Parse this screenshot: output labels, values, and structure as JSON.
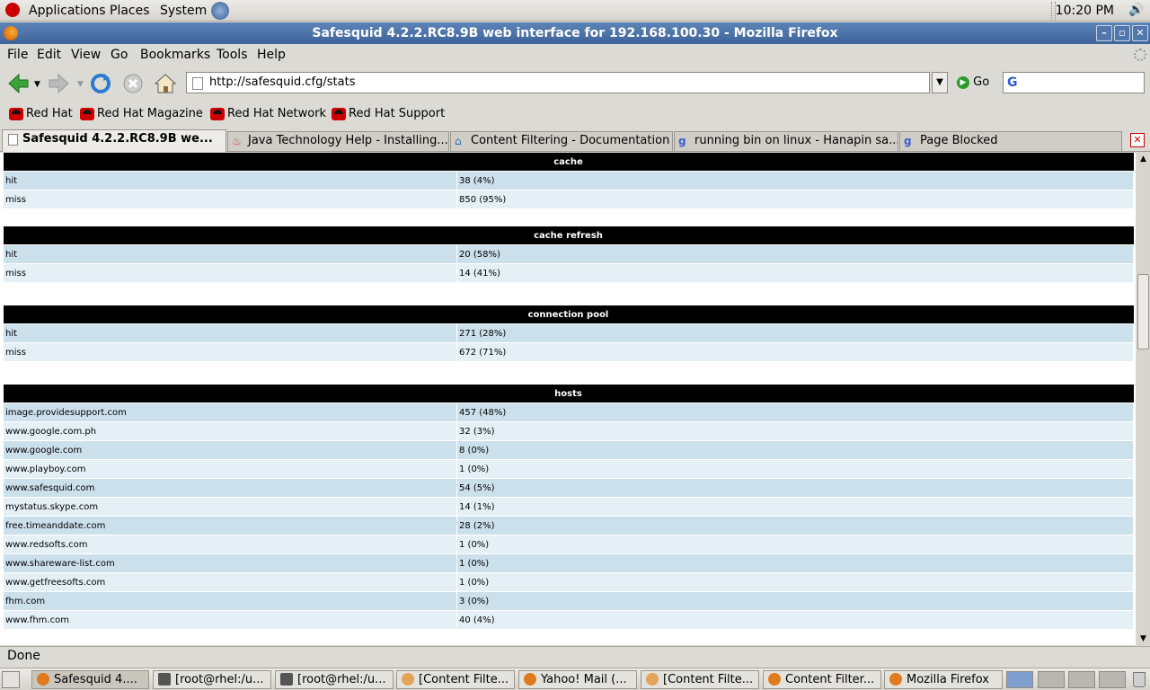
{
  "panel": {
    "menus": [
      "Applications",
      "Places",
      "System"
    ],
    "clock": "10:20 PM"
  },
  "window": {
    "title": "Safesquid 4.2.2.RC8.9B web interface for 192.168.100.30 - Mozilla Firefox"
  },
  "menubar": [
    "File",
    "Edit",
    "View",
    "Go",
    "Bookmarks",
    "Tools",
    "Help"
  ],
  "navbar": {
    "url": "http://safesquid.cfg/stats",
    "go_label": "Go"
  },
  "bookmarks": [
    "Red Hat",
    "Red Hat Magazine",
    "Red Hat Network",
    "Red Hat Support"
  ],
  "tabs": [
    "Safesquid 4.2.2.RC8.9B we...",
    "Java Technology Help - Installing...",
    "Content Filtering - Documentation",
    "running bin on linux - Hanapin sa...",
    "Page Blocked"
  ],
  "sections": {
    "cache": {
      "title": "cache",
      "rows": [
        [
          "hit",
          "38 (4%)"
        ],
        [
          "miss",
          "850 (95%)"
        ]
      ]
    },
    "cache_refresh": {
      "title": "cache refresh",
      "rows": [
        [
          "hit",
          "20 (58%)"
        ],
        [
          "miss",
          "14 (41%)"
        ]
      ]
    },
    "connection_pool": {
      "title": "connection pool",
      "rows": [
        [
          "hit",
          "271 (28%)"
        ],
        [
          "miss",
          "672 (71%)"
        ]
      ]
    },
    "hosts": {
      "title": "hosts",
      "rows": [
        [
          "image.providesupport.com",
          "457 (48%)"
        ],
        [
          "www.google.com.ph",
          "32 (3%)"
        ],
        [
          "www.google.com",
          "8 (0%)"
        ],
        [
          "www.playboy.com",
          "1 (0%)"
        ],
        [
          "www.safesquid.com",
          "54 (5%)"
        ],
        [
          "mystatus.skype.com",
          "14 (1%)"
        ],
        [
          "free.timeanddate.com",
          "28 (2%)"
        ],
        [
          "www.redsofts.com",
          "1 (0%)"
        ],
        [
          "www.shareware-list.com",
          "1 (0%)"
        ],
        [
          "www.getfreesofts.com",
          "1 (0%)"
        ],
        [
          "fhm.com",
          "3 (0%)"
        ],
        [
          "www.fhm.com",
          "40 (4%)"
        ]
      ]
    }
  },
  "status": "Done",
  "taskbar": [
    "Safesquid 4....",
    "[root@rhel:/u...",
    "[root@rhel:/u...",
    "[Content Filte...",
    "Yahoo! Mail (...",
    "[Content Filte...",
    "Content Filter...",
    "Mozilla Firefox"
  ]
}
